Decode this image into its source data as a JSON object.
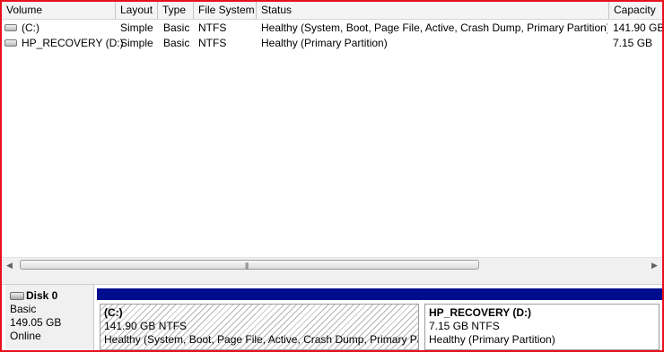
{
  "columns": [
    "Volume",
    "Layout",
    "Type",
    "File System",
    "Status",
    "Capacity"
  ],
  "volumes": [
    {
      "volume": "(C:)",
      "layout": "Simple",
      "type": "Basic",
      "fs": "NTFS",
      "status": "Healthy (System, Boot, Page File, Active, Crash Dump, Primary Partition)",
      "capacity": "141.90 GB"
    },
    {
      "volume": "HP_RECOVERY (D:)",
      "layout": "Simple",
      "type": "Basic",
      "fs": "NTFS",
      "status": "Healthy (Primary Partition)",
      "capacity": "7.15 GB"
    }
  ],
  "scrollbar": {
    "left_arrow": "◀",
    "right_arrow": "▶",
    "grip": "|||"
  },
  "disk": {
    "name": "Disk 0",
    "type": "Basic",
    "size": "149.05 GB",
    "state": "Online"
  },
  "partitions": [
    {
      "title": "(C:)",
      "size": "141.90 GB NTFS",
      "status": "Healthy (System, Boot, Page File, Active, Crash Dump, Primary Partition)",
      "selected": true
    },
    {
      "title": "HP_RECOVERY  (D:)",
      "size": "7.15 GB NTFS",
      "status": "Healthy (Primary Partition)",
      "selected": false
    }
  ],
  "colors": {
    "frame": "#e8101a",
    "partition_bar": "#000d8e"
  }
}
